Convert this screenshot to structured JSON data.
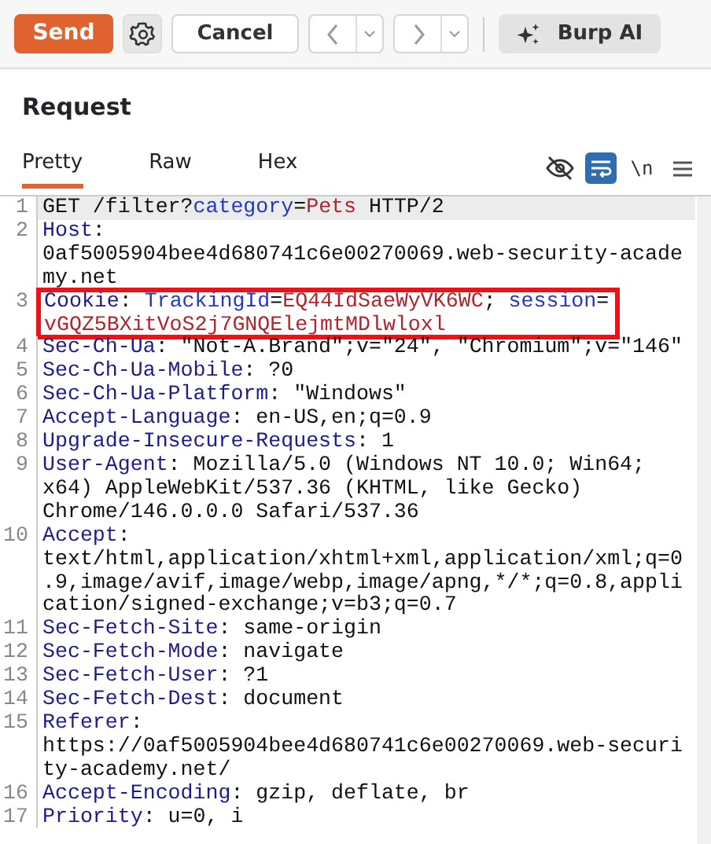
{
  "toolbar": {
    "send": "Send",
    "cancel": "Cancel",
    "ai": "Burp AI"
  },
  "panel": {
    "title": "Request"
  },
  "tabs": [
    {
      "label": "Pretty",
      "selected": true
    },
    {
      "label": "Raw",
      "selected": false
    },
    {
      "label": "Hex",
      "selected": false
    }
  ],
  "view_tools": {
    "wrap_selected": true,
    "newline_label": "\\n"
  },
  "lines": [
    {
      "number": "1",
      "current": true,
      "highlighted": false,
      "rows": [
        [
          {
            "kind": "text",
            "text": "GET /filter?"
          },
          {
            "kind": "key",
            "text": "category"
          },
          {
            "kind": "text",
            "text": "="
          },
          {
            "kind": "val",
            "text": "Pets"
          },
          {
            "kind": "text",
            "text": " HTTP/2"
          }
        ]
      ]
    },
    {
      "number": "2",
      "current": false,
      "highlighted": false,
      "rows": [
        [
          {
            "kind": "name",
            "text": "Host"
          },
          {
            "kind": "text",
            "text": ":"
          }
        ],
        [
          {
            "kind": "text",
            "text": "0af5005904bee4d680741c6e00270069.web-security-acade"
          }
        ],
        [
          {
            "kind": "text",
            "text": "my.net"
          }
        ]
      ]
    },
    {
      "number": "3",
      "current": false,
      "highlighted": true,
      "rows": [
        [
          {
            "kind": "name",
            "text": "Cookie"
          },
          {
            "kind": "text",
            "text": ": "
          },
          {
            "kind": "key",
            "text": "TrackingId"
          },
          {
            "kind": "text",
            "text": "="
          },
          {
            "kind": "val",
            "text": "EQ44IdSaeWyVK6WC"
          },
          {
            "kind": "text",
            "text": "; "
          },
          {
            "kind": "key",
            "text": "session"
          },
          {
            "kind": "text",
            "text": "="
          }
        ],
        [
          {
            "kind": "val",
            "text": "vGQZ5BXitVoS2j7GNQElejmtMDlwloxl"
          }
        ]
      ]
    },
    {
      "number": "4",
      "current": false,
      "highlighted": false,
      "rows": [
        [
          {
            "kind": "name",
            "text": "Sec-Ch-Ua"
          },
          {
            "kind": "text",
            "text": ": \"Not-A.Brand\";v=\"24\", \"Chromium\";v=\"146\""
          }
        ]
      ]
    },
    {
      "number": "5",
      "current": false,
      "highlighted": false,
      "rows": [
        [
          {
            "kind": "name",
            "text": "Sec-Ch-Ua-Mobile"
          },
          {
            "kind": "text",
            "text": ": ?0"
          }
        ]
      ]
    },
    {
      "number": "6",
      "current": false,
      "highlighted": false,
      "rows": [
        [
          {
            "kind": "name",
            "text": "Sec-Ch-Ua-Platform"
          },
          {
            "kind": "text",
            "text": ": \"Windows\""
          }
        ]
      ]
    },
    {
      "number": "7",
      "current": false,
      "highlighted": false,
      "rows": [
        [
          {
            "kind": "name",
            "text": "Accept-Language"
          },
          {
            "kind": "text",
            "text": ": en-US,en;q=0.9"
          }
        ]
      ]
    },
    {
      "number": "8",
      "current": false,
      "highlighted": false,
      "rows": [
        [
          {
            "kind": "name",
            "text": "Upgrade-Insecure-Requests"
          },
          {
            "kind": "text",
            "text": ": 1"
          }
        ]
      ]
    },
    {
      "number": "9",
      "current": false,
      "highlighted": false,
      "rows": [
        [
          {
            "kind": "name",
            "text": "User-Agent"
          },
          {
            "kind": "text",
            "text": ": Mozilla/5.0 (Windows NT 10.0; Win64;"
          }
        ],
        [
          {
            "kind": "text",
            "text": "x64) AppleWebKit/537.36 (KHTML, like Gecko)"
          }
        ],
        [
          {
            "kind": "text",
            "text": "Chrome/146.0.0.0 Safari/537.36"
          }
        ]
      ]
    },
    {
      "number": "10",
      "current": false,
      "highlighted": false,
      "rows": [
        [
          {
            "kind": "name",
            "text": "Accept"
          },
          {
            "kind": "text",
            "text": ":"
          }
        ],
        [
          {
            "kind": "text",
            "text": "text/html,application/xhtml+xml,application/xml;q=0"
          }
        ],
        [
          {
            "kind": "text",
            "text": ".9,image/avif,image/webp,image/apng,*/*;q=0.8,appli"
          }
        ],
        [
          {
            "kind": "text",
            "text": "cation/signed-exchange;v=b3;q=0.7"
          }
        ]
      ]
    },
    {
      "number": "11",
      "current": false,
      "highlighted": false,
      "rows": [
        [
          {
            "kind": "name",
            "text": "Sec-Fetch-Site"
          },
          {
            "kind": "text",
            "text": ": same-origin"
          }
        ]
      ]
    },
    {
      "number": "12",
      "current": false,
      "highlighted": false,
      "rows": [
        [
          {
            "kind": "name",
            "text": "Sec-Fetch-Mode"
          },
          {
            "kind": "text",
            "text": ": navigate"
          }
        ]
      ]
    },
    {
      "number": "13",
      "current": false,
      "highlighted": false,
      "rows": [
        [
          {
            "kind": "name",
            "text": "Sec-Fetch-User"
          },
          {
            "kind": "text",
            "text": ": ?1"
          }
        ]
      ]
    },
    {
      "number": "14",
      "current": false,
      "highlighted": false,
      "rows": [
        [
          {
            "kind": "name",
            "text": "Sec-Fetch-Dest"
          },
          {
            "kind": "text",
            "text": ": document"
          }
        ]
      ]
    },
    {
      "number": "15",
      "current": false,
      "highlighted": false,
      "rows": [
        [
          {
            "kind": "name",
            "text": "Referer"
          },
          {
            "kind": "text",
            "text": ":"
          }
        ],
        [
          {
            "kind": "text",
            "text": "https://0af5005904bee4d680741c6e00270069.web-securi"
          }
        ],
        [
          {
            "kind": "text",
            "text": "ty-academy.net/"
          }
        ]
      ]
    },
    {
      "number": "16",
      "current": false,
      "highlighted": false,
      "rows": [
        [
          {
            "kind": "name",
            "text": "Accept-Encoding"
          },
          {
            "kind": "text",
            "text": ": gzip, deflate, br"
          }
        ]
      ]
    },
    {
      "number": "17",
      "current": false,
      "highlighted": false,
      "rows": [
        [
          {
            "kind": "name",
            "text": "Priority"
          },
          {
            "kind": "text",
            "text": ": u=0, i"
          }
        ]
      ]
    }
  ]
}
